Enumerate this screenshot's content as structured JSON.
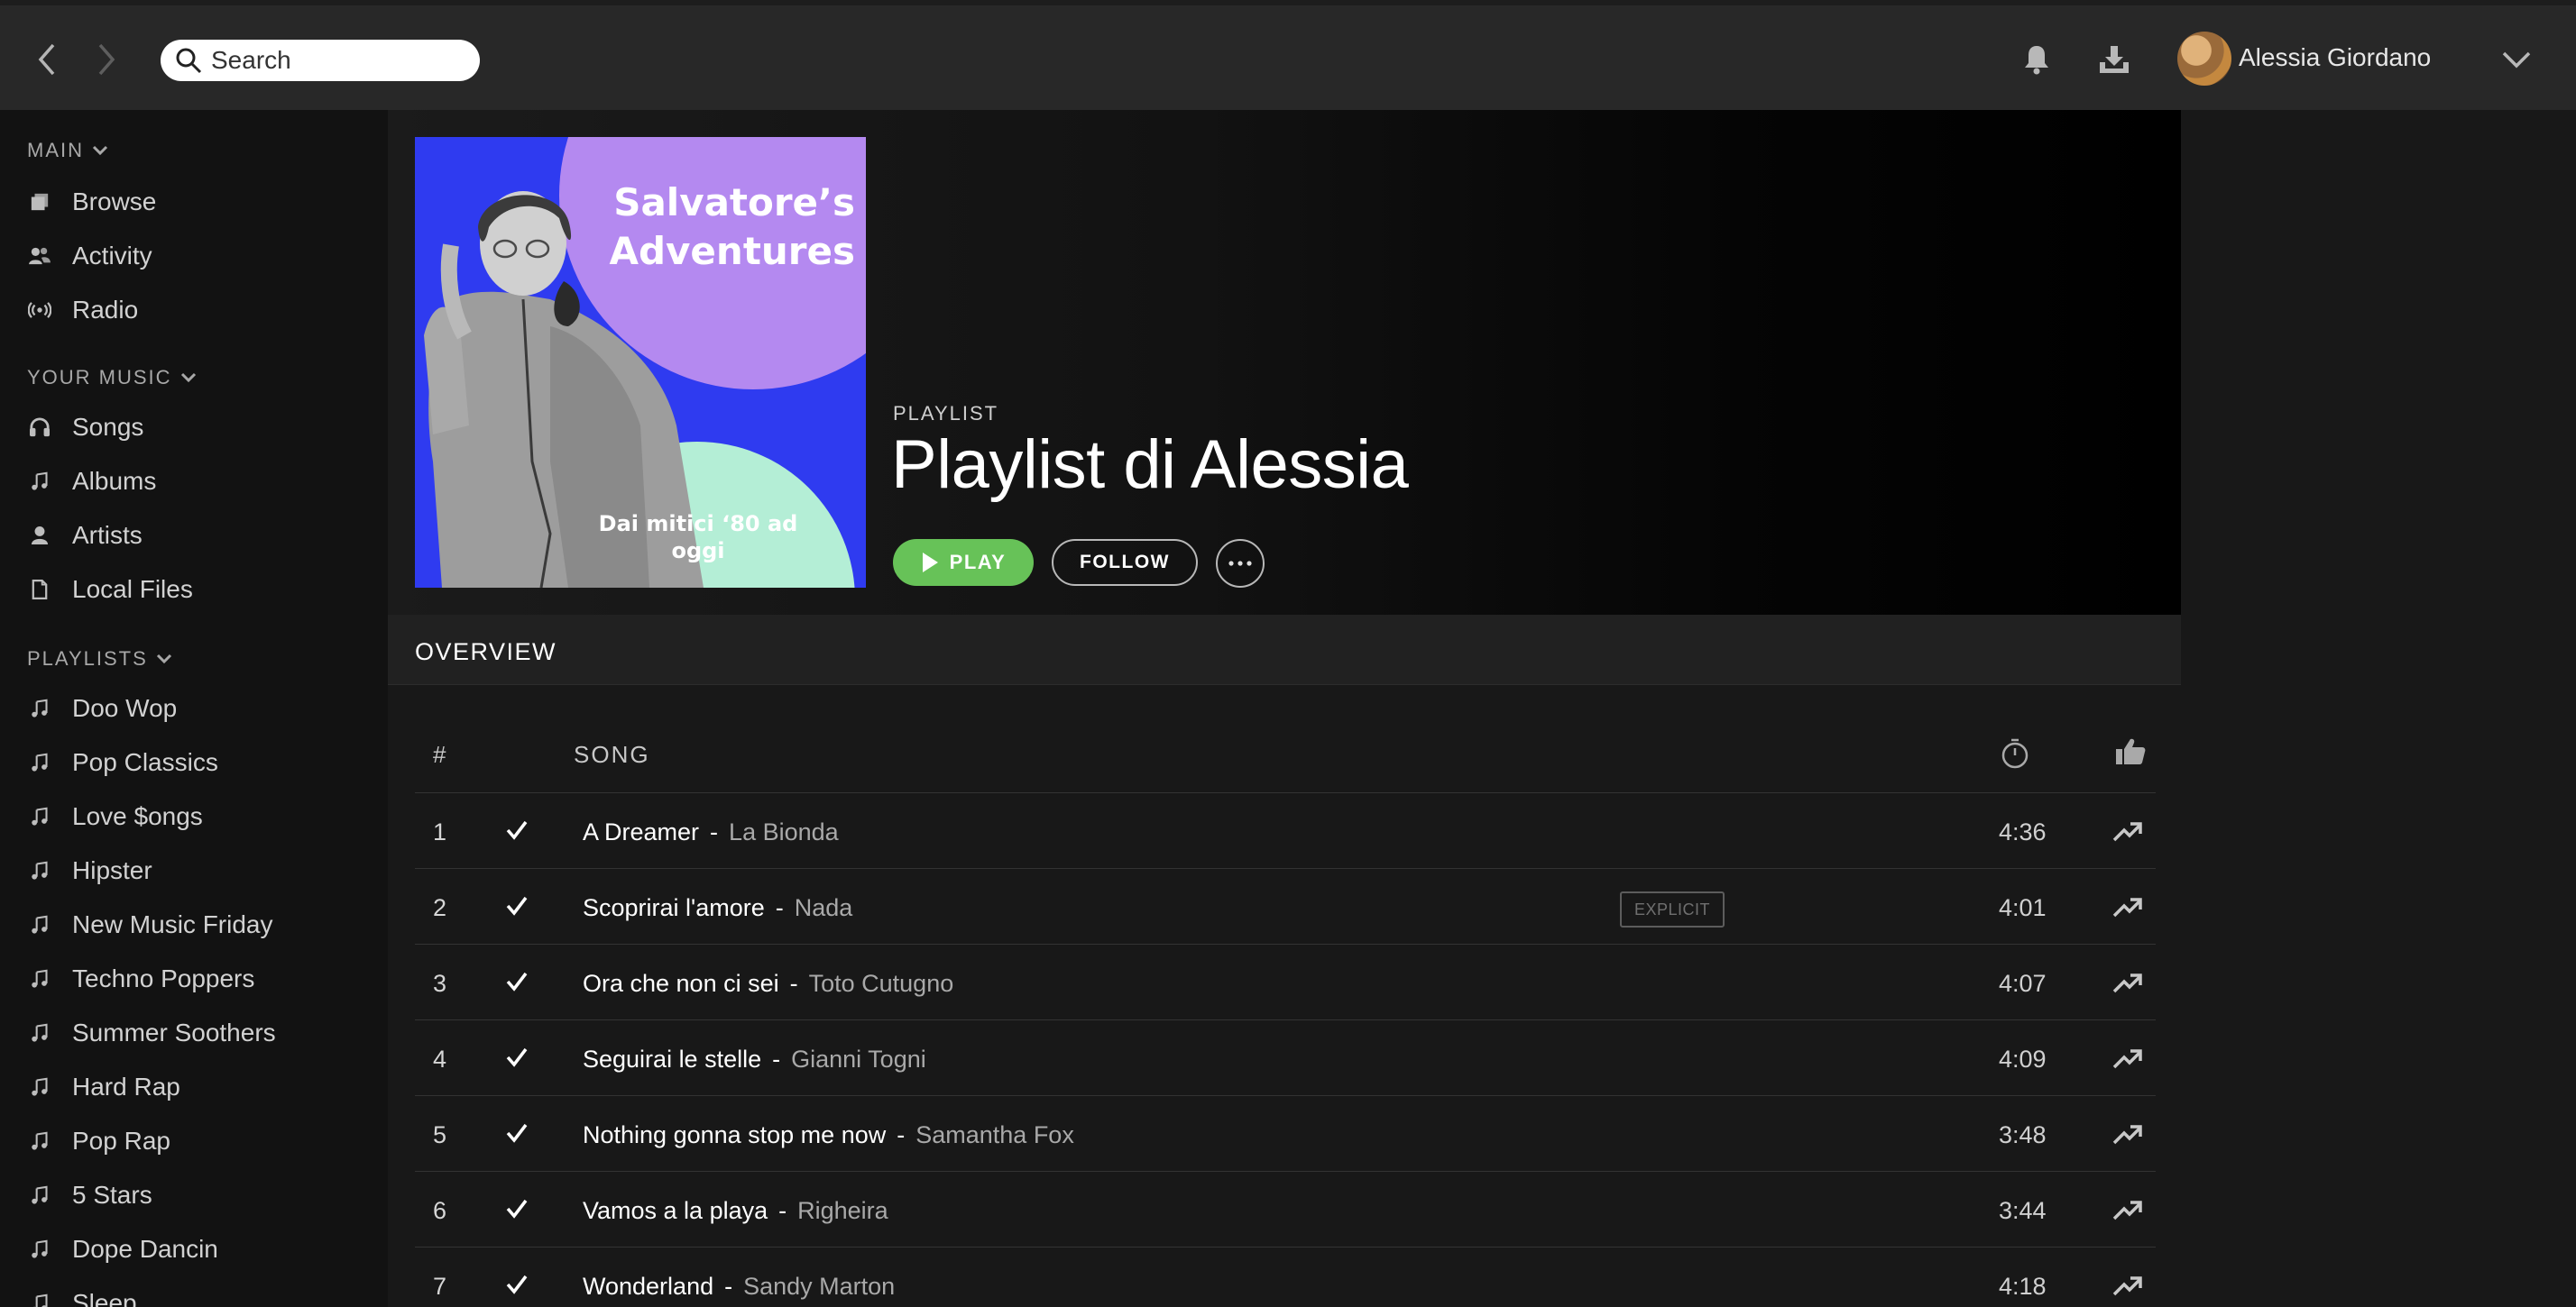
{
  "topbar": {
    "search_placeholder": "Search",
    "user_name": "Alessia Giordano"
  },
  "sidebar": {
    "main": {
      "title": "MAIN",
      "items": [
        {
          "label": "Browse",
          "icon": "browse-icon"
        },
        {
          "label": "Activity",
          "icon": "activity-icon"
        },
        {
          "label": "Radio",
          "icon": "radio-icon"
        }
      ]
    },
    "your_music": {
      "title": "YOUR MUSIC",
      "items": [
        {
          "label": "Songs",
          "icon": "headphones-icon"
        },
        {
          "label": "Albums",
          "icon": "music-note-icon"
        },
        {
          "label": "Artists",
          "icon": "person-icon"
        },
        {
          "label": "Local Files",
          "icon": "file-icon"
        }
      ]
    },
    "playlists": {
      "title": "PLAYLISTS",
      "items": [
        {
          "label": "Doo Wop"
        },
        {
          "label": "Pop Classics"
        },
        {
          "label": "Love $ongs"
        },
        {
          "label": "Hipster"
        },
        {
          "label": "New Music Friday"
        },
        {
          "label": "Techno Poppers"
        },
        {
          "label": "Summer Soothers"
        },
        {
          "label": "Hard Rap"
        },
        {
          "label": "Pop Rap"
        },
        {
          "label": "5 Stars"
        },
        {
          "label": "Dope Dancin"
        },
        {
          "label": "Sleep"
        }
      ]
    }
  },
  "header": {
    "cover_title": "Salvatore’s Adventures",
    "cover_subtitle": "Dai mitici ‘80 ad oggi",
    "type": "PLAYLIST",
    "title": "Playlist di Alessia",
    "play_label": "PLAY",
    "follow_label": "FOLLOW"
  },
  "tabs": {
    "overview": "OVERVIEW"
  },
  "tracklist": {
    "columns": {
      "number": "#",
      "song": "SONG"
    },
    "explicit_label": "EXPLICIT",
    "rows": [
      {
        "num": "1",
        "title": "A Dreamer",
        "artist": "La Bionda",
        "duration": "4:36",
        "explicit": false
      },
      {
        "num": "2",
        "title": "Scoprirai l'amore",
        "artist": "Nada",
        "duration": "4:01",
        "explicit": true
      },
      {
        "num": "3",
        "title": "Ora che non ci sei",
        "artist": "Toto Cutugno",
        "duration": "4:07",
        "explicit": false
      },
      {
        "num": "4",
        "title": "Seguirai le stelle",
        "artist": "Gianni Togni",
        "duration": "4:09",
        "explicit": false
      },
      {
        "num": "5",
        "title": "Nothing gonna stop me now",
        "artist": "Samantha Fox",
        "duration": "3:48",
        "explicit": false
      },
      {
        "num": "6",
        "title": "Vamos a la playa",
        "artist": "Righeira",
        "duration": "3:44",
        "explicit": false
      },
      {
        "num": "7",
        "title": "Wonderland",
        "artist": "Sandy Marton",
        "duration": "4:18",
        "explicit": false
      }
    ]
  },
  "colors": {
    "accent_green": "#67c258",
    "cover_blue": "#2f3bf0",
    "cover_purple": "#b489f0",
    "cover_mint": "#b4eed6"
  }
}
